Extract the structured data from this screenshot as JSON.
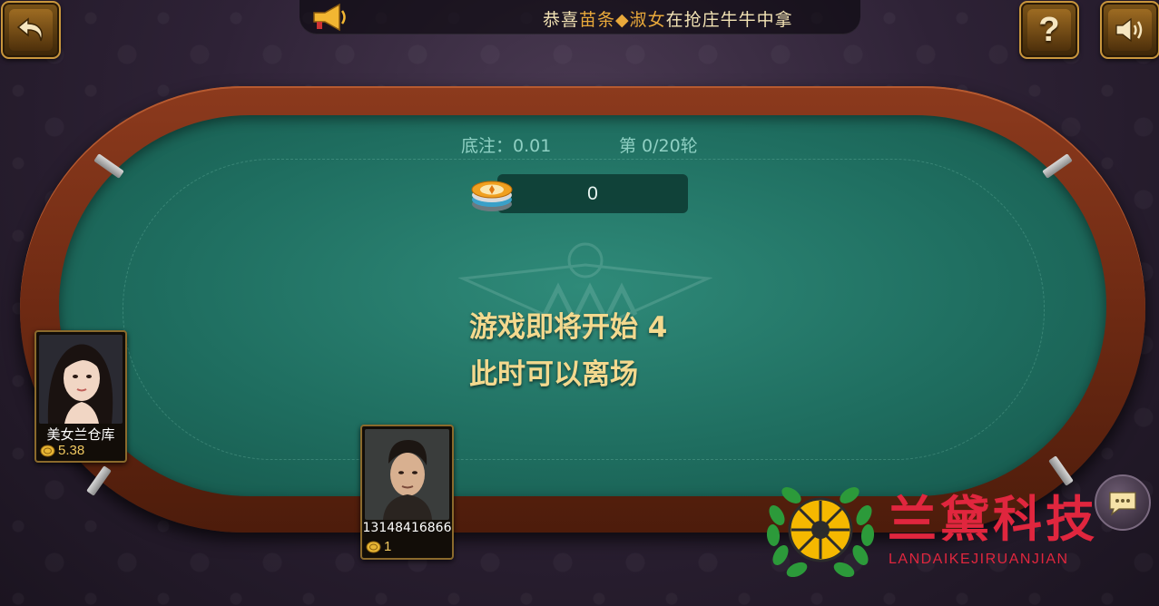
{
  "marquee": {
    "prefix": "恭喜",
    "player_name": "苗条◆淑女",
    "middle": "在抢庄牛牛",
    "suffix": "中拿"
  },
  "header": {
    "back_icon": "back-arrow-icon",
    "help_label": "?",
    "sound_icon": "speaker-icon"
  },
  "table": {
    "base_bet": "底注：0.01",
    "round": "第 0/20轮",
    "pot": "0"
  },
  "status": {
    "line1": "游戏即将开始  4",
    "line2": "此时可以离场"
  },
  "players": [
    {
      "name": "美女兰仓库",
      "coins": "5.38"
    },
    {
      "name": "13148416866",
      "coins": "1"
    }
  ],
  "watermark": {
    "title": "兰黛科技",
    "subtitle": "LANDAIKEJIRUANJIAN"
  },
  "colors": {
    "felt": "#1f6e60",
    "rim": "#6e2a13",
    "gold": "#f3d98e",
    "watermark": "#e0263e"
  }
}
